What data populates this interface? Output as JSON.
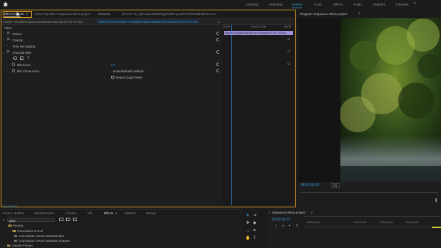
{
  "workspaces": {
    "items": [
      "Learning",
      "Assembly",
      "Editing",
      "Color",
      "Effects",
      "Audio",
      "Graphics",
      "Libraries"
    ],
    "active_index": 2,
    "more": "»"
  },
  "effect_controls": {
    "tabs": [
      {
        "label": "Effect Controls",
        "active": true
      },
      {
        "label": "Audio Clip Mixer: Sequence demo project",
        "active": false
      },
      {
        "label": "Metadata",
        "active": false
      },
      {
        "label": "Source: 21_Uploaded Wi%2Fbyia%2Fb.js%2F%2F00%2520lines.mov",
        "active": false
      }
    ],
    "master_label": "Master * beautiful tropical waterfall bali indonesia 4K HD TW.mov",
    "sequence_label": "Sequence demo project * beautiful tropical waterfall bali indonesia 4K HD TW.mov",
    "sections": [
      {
        "label": "Video",
        "type": "header"
      },
      {
        "label": "Motion",
        "type": "fx"
      },
      {
        "label": "Opacity",
        "type": "fx"
      },
      {
        "label": "Time Remapping",
        "type": "plain"
      },
      {
        "label": "Gaussian Blur",
        "type": "fx"
      }
    ],
    "blur_params": [
      {
        "label": "Blurriness",
        "value": "0.0"
      },
      {
        "label": "Blur Dimensions",
        "value": "Horizontal and Vertical"
      },
      {
        "label": "",
        "value": "Repeat Edge Pixels"
      }
    ],
    "ruler": [
      "00;00",
      "00;01;12;00",
      "00;03"
    ],
    "clip_label": "beautiful tropical waterfall bali indonesia 4K HD TW.mov",
    "timecode": "00;02;58;25"
  },
  "program_monitor": {
    "title": "Program: Sequence demo project",
    "timecode": "00;02;58;25",
    "fit": "Fit"
  },
  "project_panel": {
    "tabs": [
      "Project: Untitled",
      "Media Browser",
      "Libraries",
      "Info",
      "Effects",
      "Markers",
      "History"
    ],
    "active_tab": 4,
    "search_value": "gaus",
    "tree": [
      {
        "label": "Presets",
        "depth": 0
      },
      {
        "label": "Convolution Kernel",
        "depth": 1
      },
      {
        "label": "Convolution Kernel Gaussian Blur",
        "depth": 2
      },
      {
        "label": "Convolution Kernel Gaussian Sharpen",
        "depth": 2
      },
      {
        "label": "Lumetri Presets",
        "depth": 0
      }
    ]
  },
  "sequence_panel": {
    "title": "Sequence demo project",
    "timecode": "00;02;58;25",
    "ruler": [
      "00;00;32;00",
      "00;01;04;02",
      "00;01;36;02",
      "00;02;08;04"
    ]
  },
  "colors": {
    "accent": "#3a9ad9",
    "focus_border": "#e6a020",
    "clip": "#9f8fd8"
  }
}
